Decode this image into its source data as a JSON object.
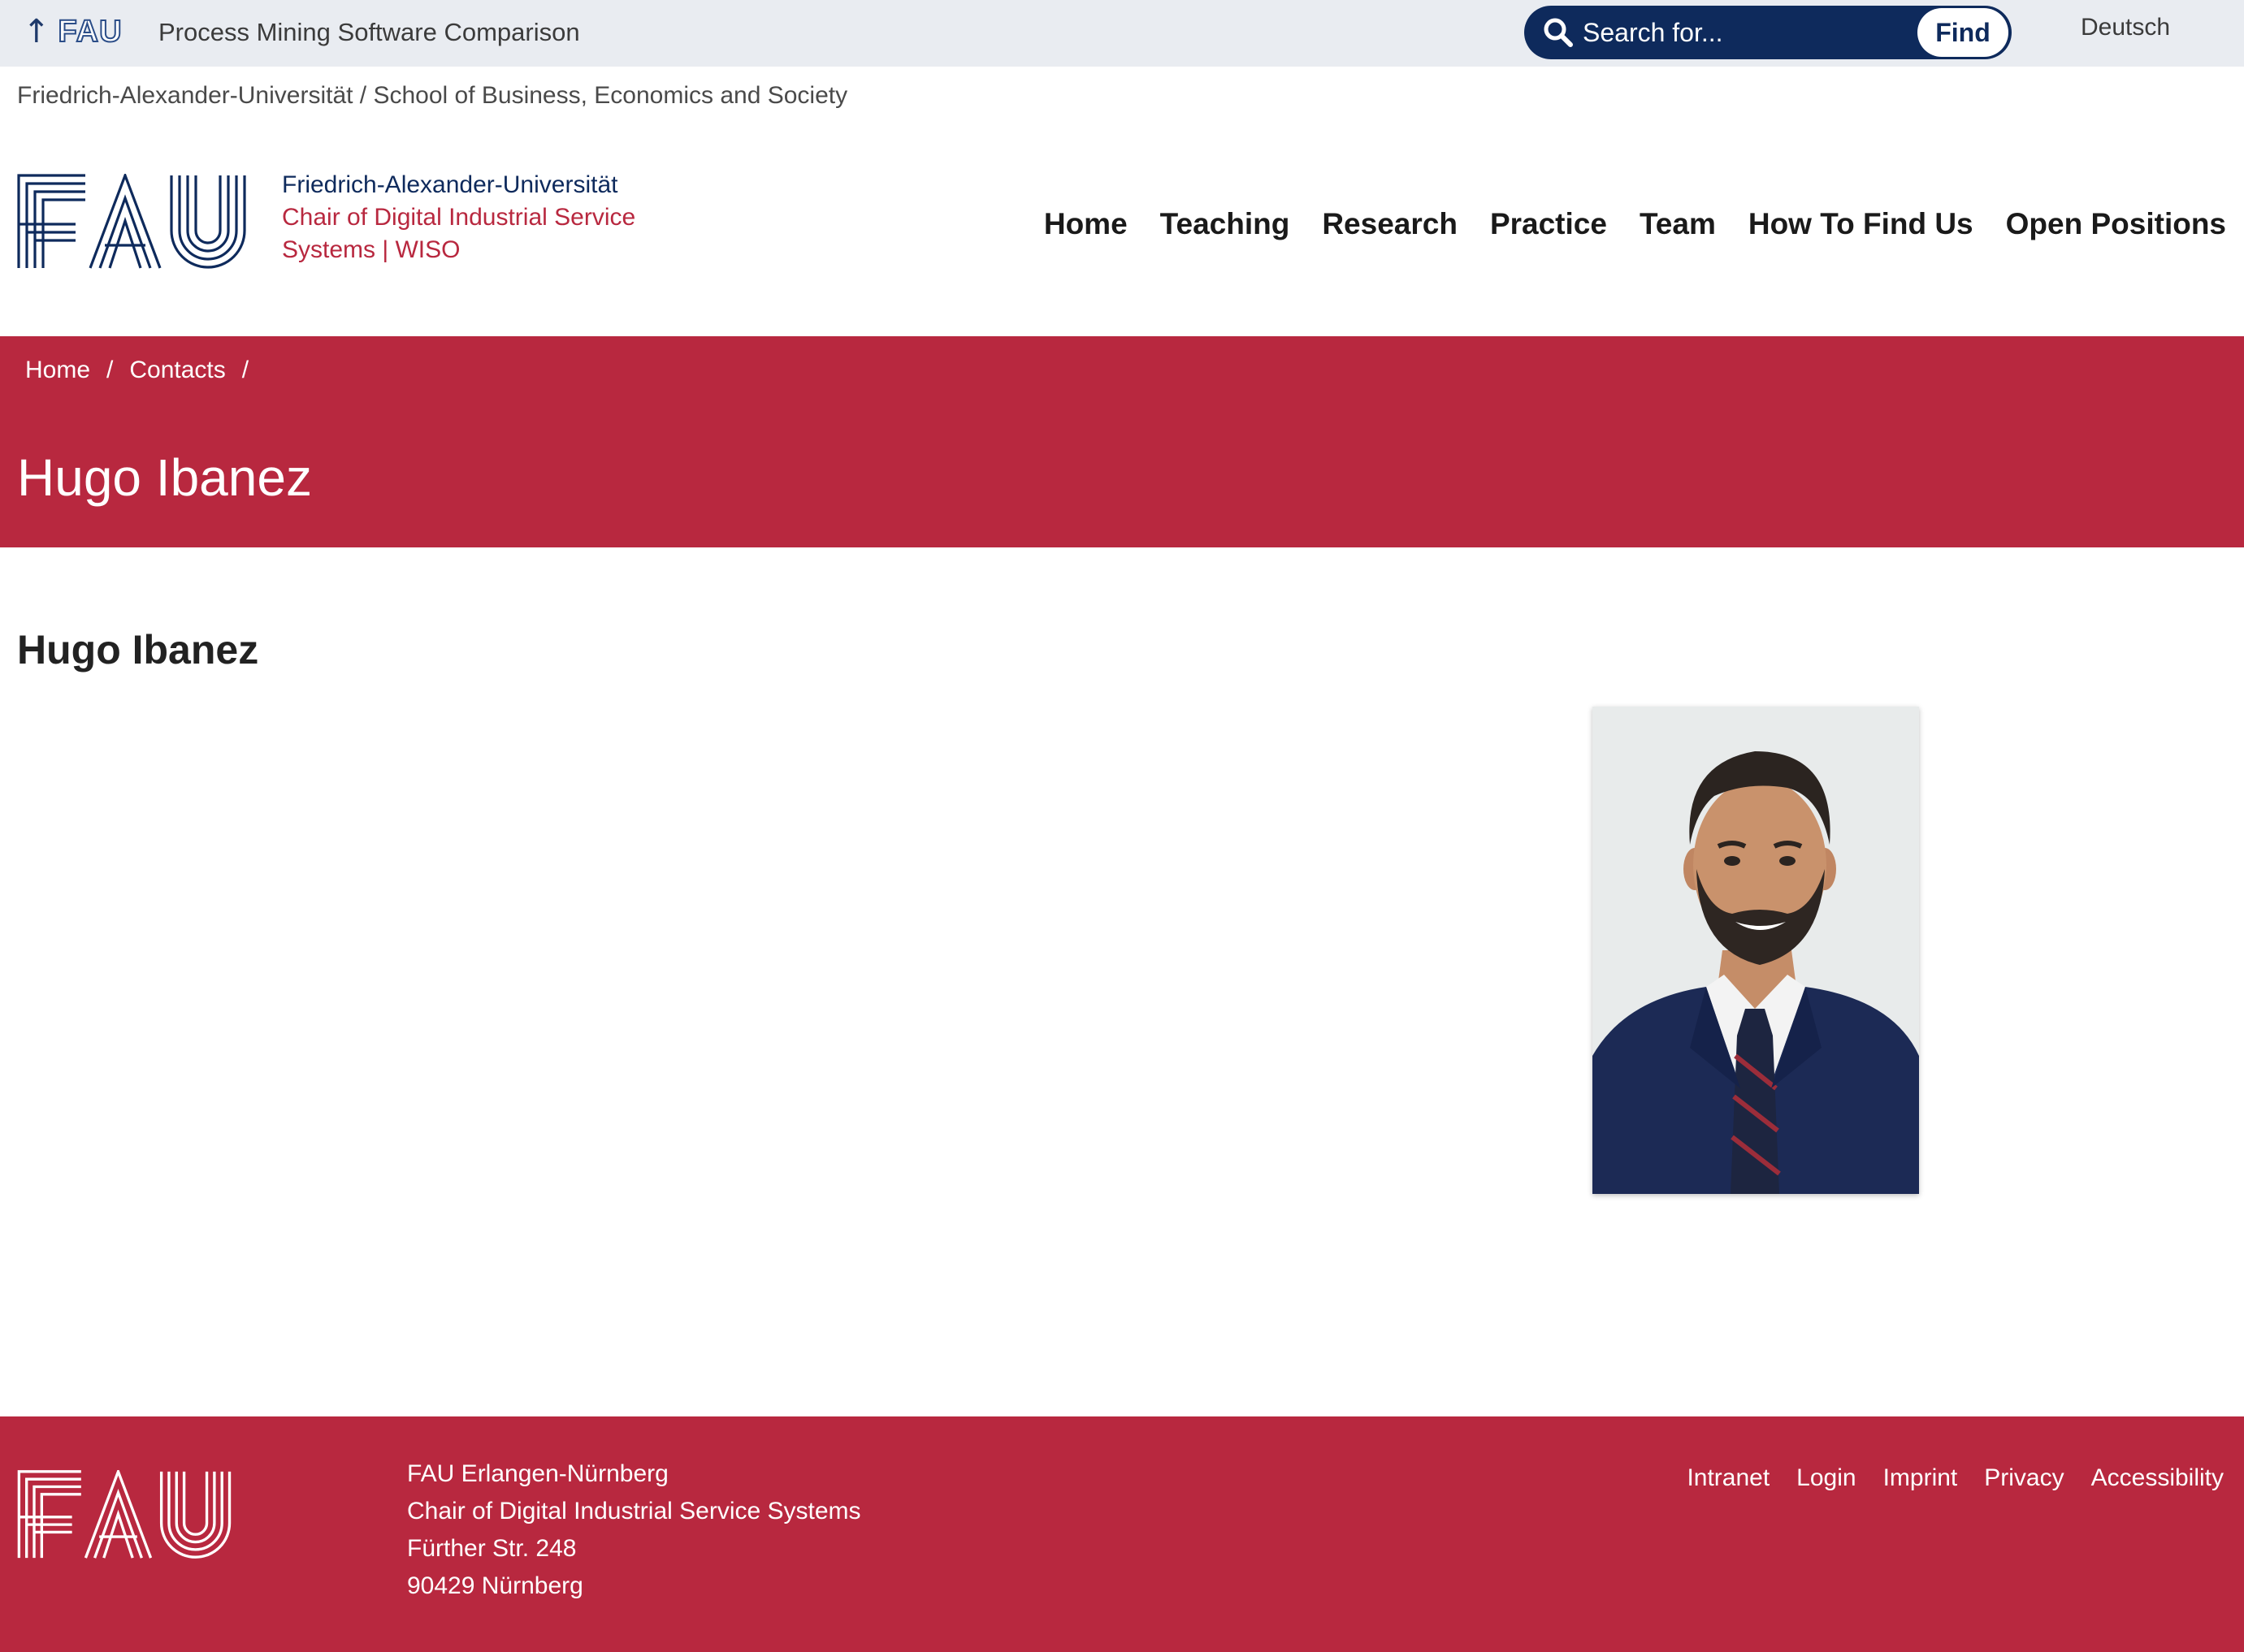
{
  "topbar": {
    "fau_up_arrow": "↑",
    "fau_mini_logo": "FAU",
    "site_title": "Process Mining Software Comparison",
    "search_placeholder": "Search for...",
    "find_label": "Find",
    "language": "Deutsch"
  },
  "org_breadcrumb": "Friedrich-Alexander-Universität / School of Business, Economics and Society",
  "logo": {
    "wordmark": "FAU",
    "line1": "Friedrich-Alexander-Universität",
    "line2": "Chair of Digital Industrial Service",
    "line3": "Systems | WISO"
  },
  "nav": {
    "items": [
      "Home",
      "Teaching",
      "Research",
      "Practice",
      "Team",
      "How To Find Us",
      "Open Positions"
    ]
  },
  "breadcrumb": {
    "home": "Home",
    "contacts": "Contacts",
    "separator": "/"
  },
  "hero": {
    "title": "Hugo Ibanez"
  },
  "main": {
    "name_heading": "Hugo Ibanez",
    "portrait_icon": "person-portrait-photo"
  },
  "footer": {
    "logo": "FAU",
    "address": {
      "line1": "FAU Erlangen-Nürnberg",
      "line2": "Chair of Digital Industrial Service Systems",
      "line3": "Fürther Str. 248",
      "line4": "90429 Nürnberg"
    },
    "links": [
      "Intranet",
      "Login",
      "Imprint",
      "Privacy",
      "Accessibility"
    ]
  },
  "colors": {
    "brand_red": "#b8283f",
    "brand_navy": "#0e2a5c",
    "topbar_bg": "#e9ecf1"
  }
}
